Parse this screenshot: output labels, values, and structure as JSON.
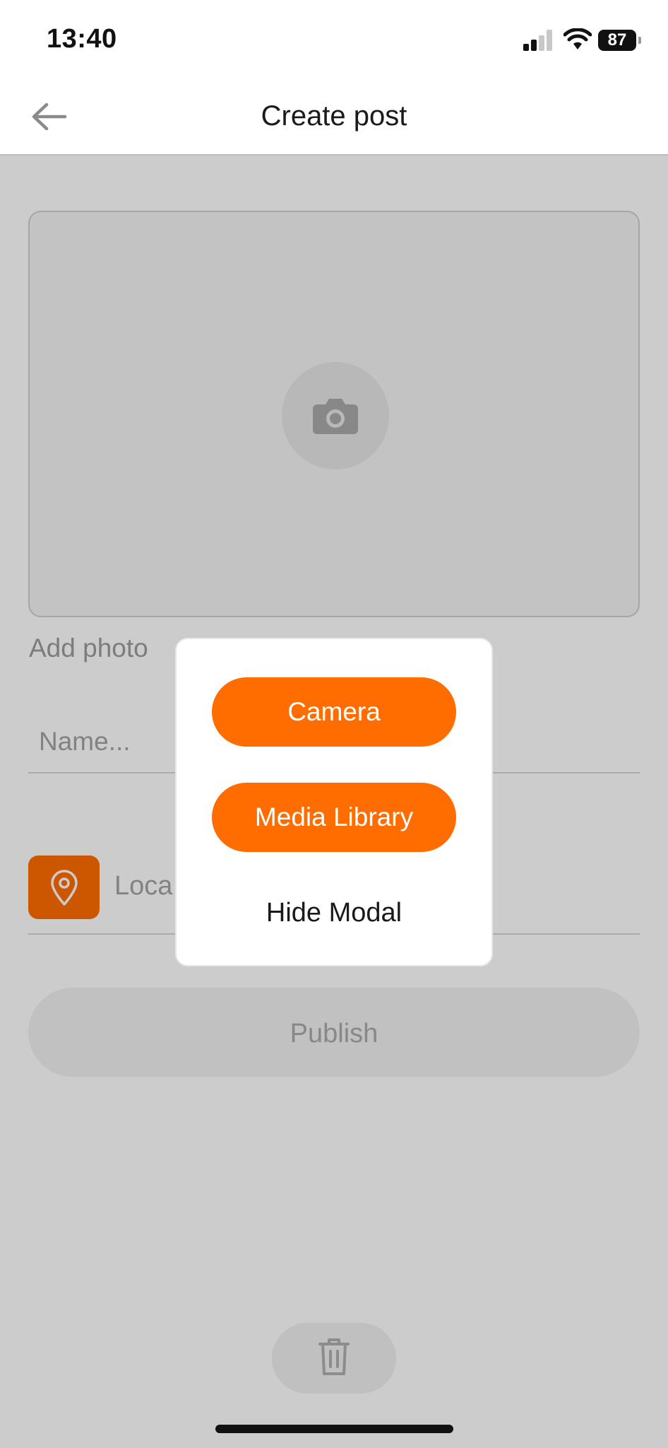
{
  "status_bar": {
    "time": "13:40",
    "battery": "87"
  },
  "nav": {
    "title": "Create post"
  },
  "form": {
    "add_photo_label": "Add photo",
    "name_placeholder": "Name...",
    "location_text": "Loca",
    "publish_label": "Publish"
  },
  "modal": {
    "camera_label": "Camera",
    "media_library_label": "Media Library",
    "hide_label": "Hide Modal"
  },
  "icons": [
    "back-arrow-icon",
    "camera-icon",
    "location-pin-icon",
    "trash-icon",
    "signal-icon",
    "wifi-icon",
    "battery-icon"
  ],
  "colors": {
    "accent": "#ff6d00",
    "overlay": "rgba(0,0,0,0.2)"
  }
}
